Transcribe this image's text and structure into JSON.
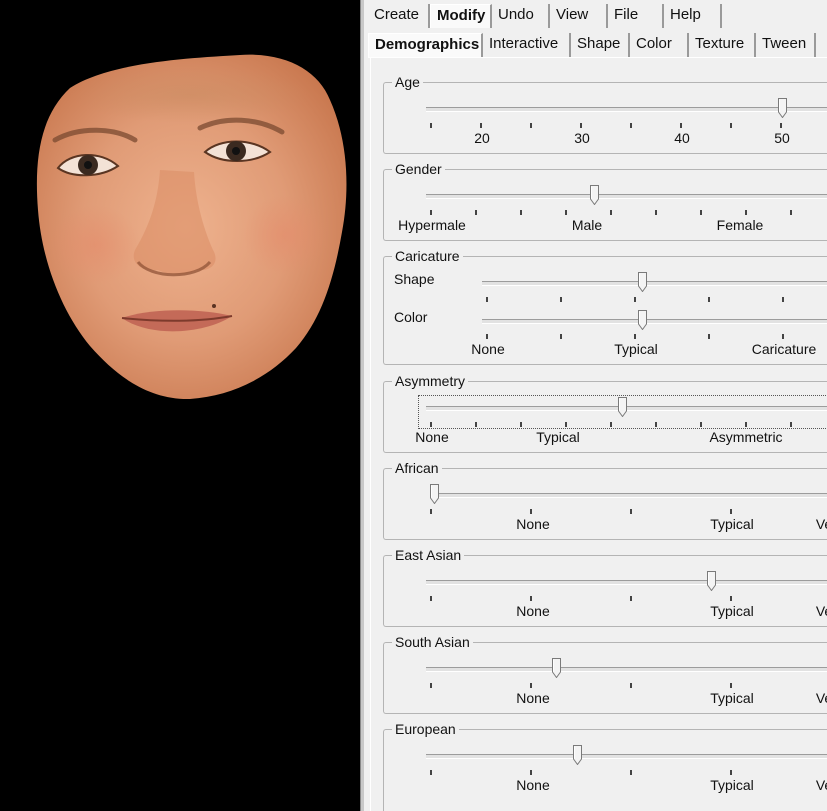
{
  "menu_tabs": [
    "Create",
    "Modify",
    "Undo",
    "View",
    "File",
    "Help"
  ],
  "sub_tabs": [
    "Demographics",
    "Interactive",
    "Shape",
    "Color",
    "Texture",
    "Tween"
  ],
  "groups": {
    "age": {
      "title": "Age",
      "labels": [
        "20",
        "30",
        "40",
        "50"
      ],
      "value_fraction": 0.88
    },
    "gender": {
      "title": "Gender",
      "labels": [
        "Hypermale",
        "Male",
        "Female"
      ],
      "value_fraction": 0.41
    },
    "caricature": {
      "title": "Caricature",
      "shape_label": "Shape",
      "color_label": "Color",
      "labels": [
        "None",
        "Typical",
        "Caricature"
      ],
      "shape_fraction": 0.46,
      "color_fraction": 0.46
    },
    "asymmetry": {
      "title": "Asymmetry",
      "labels": [
        "None",
        "Typical",
        "Asymmetric"
      ],
      "value_fraction": 0.48
    },
    "african": {
      "title": "African",
      "labels": [
        "None",
        "Typical",
        "Ve"
      ],
      "value_fraction": 0.0
    },
    "east_asian": {
      "title": "East Asian",
      "labels": [
        "None",
        "Typical",
        "Ve"
      ],
      "value_fraction": 0.67
    },
    "south_asian": {
      "title": "South Asian",
      "labels": [
        "None",
        "Typical",
        "Ve"
      ],
      "value_fraction": 0.3
    },
    "european": {
      "title": "European",
      "labels": [
        "None",
        "Typical",
        "Ve"
      ],
      "value_fraction": 0.35
    }
  },
  "colors": {
    "viewport_bg": "#000000",
    "panel_bg": "#f0f0f0",
    "skin": "#e0a07c"
  }
}
